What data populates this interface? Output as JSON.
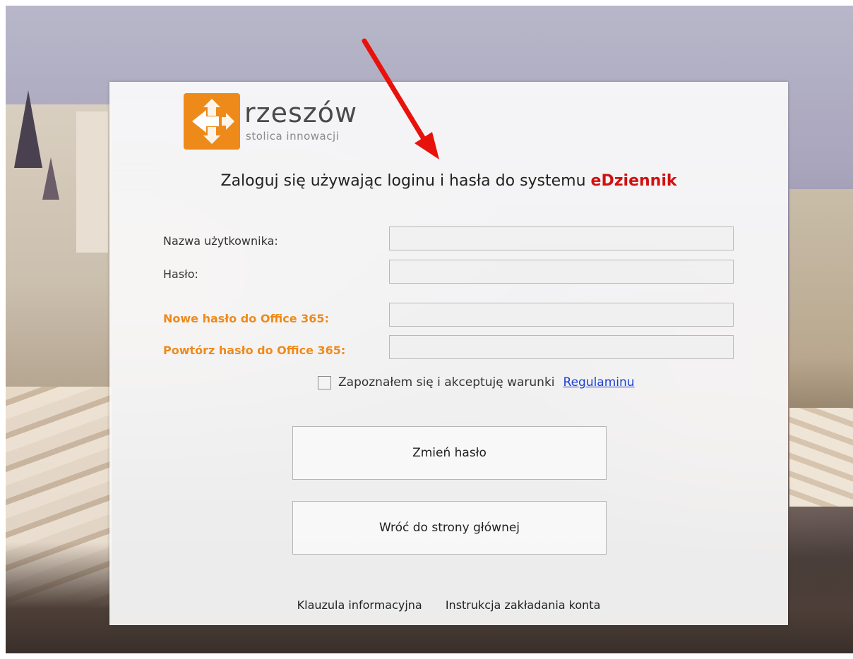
{
  "logo": {
    "name": "rzeszów",
    "tagline": "stolica innowacji",
    "badge_color": "#ee8a1a"
  },
  "heading": {
    "text": "Zaloguj się używając loginu i hasła do systemu ",
    "system": "eDziennik",
    "system_color": "#d21010"
  },
  "form": {
    "username_label": "Nazwa użytkownika:",
    "username_value": "",
    "password_label": "Hasło:",
    "password_value": "",
    "new_office_password_label": "Nowe hasło do Office 365:",
    "new_office_password_value": "",
    "repeat_office_password_label": "Powtórz hasło do Office 365:",
    "repeat_office_password_value": ""
  },
  "terms": {
    "checked": false,
    "text": "Zapoznałem się i akceptuję warunki",
    "link": "Regulaminu"
  },
  "buttons": {
    "change_password": "Zmień hasło",
    "back_home": "Wróć do strony głównej"
  },
  "footer": {
    "info_clause": "Klauzula informacyjna",
    "account_instructions": "Instrukcja zakładania konta"
  },
  "annotation": {
    "arrow_color": "#e8120c"
  }
}
